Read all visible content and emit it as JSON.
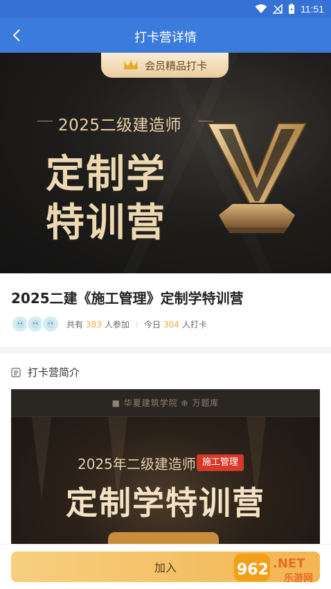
{
  "status_bar": {
    "time": "11:51"
  },
  "nav": {
    "title": "打卡营详情"
  },
  "banner": {
    "badge": "会员精品打卡",
    "subtitle": "2025二级建造师",
    "line1": "定制学",
    "line2": "特训营"
  },
  "course": {
    "title": "2025二建《施工管理》定制学特训营",
    "stats": {
      "total_prefix": "共有",
      "total_count": "383",
      "total_suffix": "人参加",
      "today_prefix": "今日",
      "today_count": "304",
      "today_suffix": "人打卡"
    }
  },
  "intro": {
    "section_title": "打卡营简介",
    "image_logos": "■ 华夏建筑学院    ⊕ 万题库",
    "image_year": "2025年二级建造师",
    "image_tag": "施工管理",
    "image_title": "定制学特训营"
  },
  "footer": {
    "join_label": "加入"
  },
  "watermark": {
    "text1": "962",
    "text2": ".NET",
    "text3": "乐游网"
  },
  "colors": {
    "nav": "#3b7bdc",
    "accent": "#f0a93b",
    "button": "#f5c46a"
  }
}
